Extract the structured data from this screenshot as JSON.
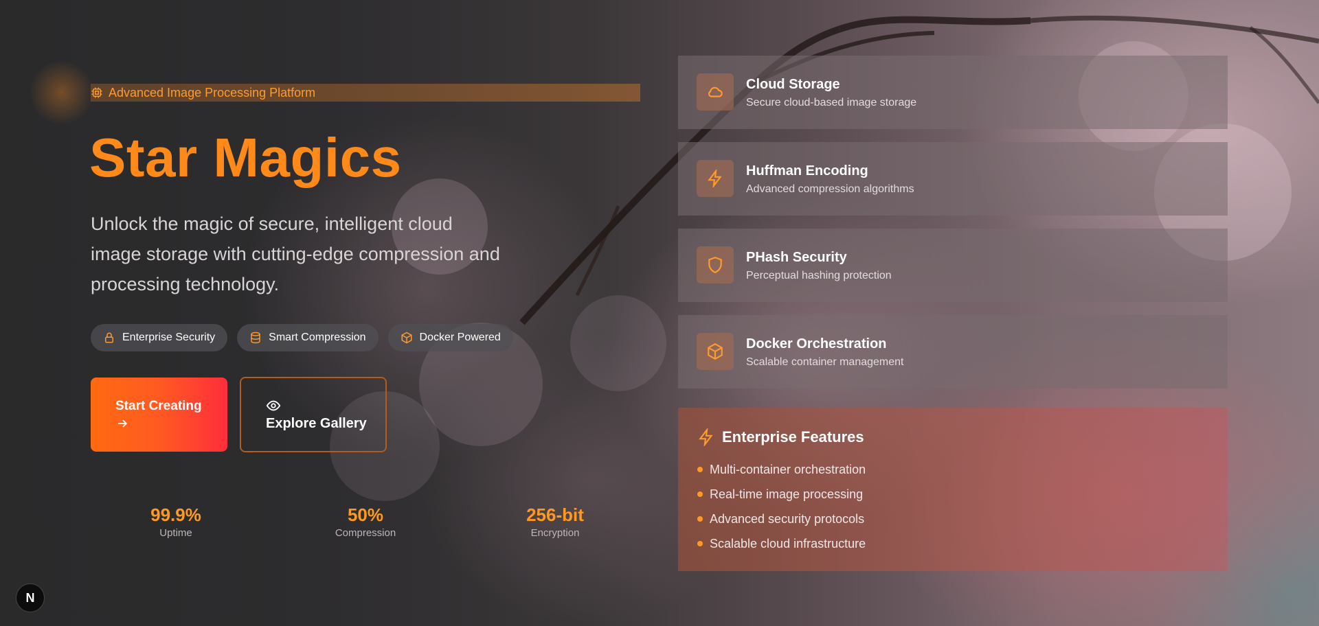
{
  "hero": {
    "tagline": "Advanced Image Processing Platform",
    "title": "Star Magics",
    "subtitle": "Unlock the magic of secure, intelligent cloud image storage with cutting-edge compression and processing technology.",
    "pills": [
      {
        "label": "Enterprise Security",
        "icon": "lock-icon"
      },
      {
        "label": "Smart Compression",
        "icon": "database-icon"
      },
      {
        "label": "Docker Powered",
        "icon": "box-icon"
      }
    ],
    "primary_button": "Start Creating",
    "secondary_button": "Explore Gallery",
    "stats": [
      {
        "value": "99.9%",
        "label": "Uptime"
      },
      {
        "value": "50%",
        "label": "Compression"
      },
      {
        "value": "256-bit",
        "label": "Encryption"
      }
    ]
  },
  "features": [
    {
      "title": "Cloud Storage",
      "desc": "Secure cloud-based image storage",
      "icon": "cloud-icon"
    },
    {
      "title": "Huffman Encoding",
      "desc": "Advanced compression algorithms",
      "icon": "lightning-icon"
    },
    {
      "title": "PHash Security",
      "desc": "Perceptual hashing protection",
      "icon": "shield-icon"
    },
    {
      "title": "Docker Orchestration",
      "desc": "Scalable container management",
      "icon": "box-icon"
    }
  ],
  "enterprise": {
    "title": "Enterprise Features",
    "items": [
      "Multi-container orchestration",
      "Real-time image processing",
      "Advanced security protocols",
      "Scalable cloud infrastructure"
    ]
  },
  "badge": {
    "label": "N"
  },
  "colors": {
    "accent": "#ff8a1a",
    "gradient_start": "#ff6a10",
    "gradient_end": "#ff2e3c"
  }
}
